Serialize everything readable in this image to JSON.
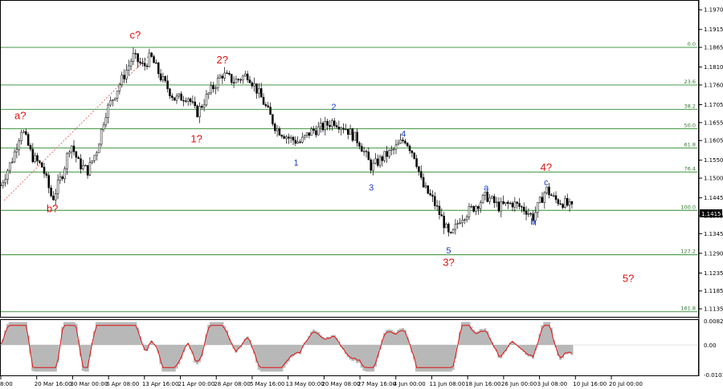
{
  "chart_data": {
    "type": "candlestick",
    "price_axis": {
      "ticks": [
        "1.1970",
        "1.1915",
        "1.1865",
        "1.1810",
        "1.1760",
        "1.1705",
        "1.1655",
        "1.1605",
        "1.1550",
        "1.1500",
        "1.1445",
        "1.1395",
        "1.1345",
        "1.1290",
        "1.1235",
        "1.1185",
        "1.1135"
      ],
      "range": [
        1.1115,
        1.1995
      ],
      "current_price": "1.1415"
    },
    "time_axis": {
      "labels": [
        "8:00",
        "20 Mar 16:00",
        "30 Mar 00:00",
        "6 Apr 08:00",
        "13 Apr 16:00",
        "21 Apr 00:00",
        "28 Apr 08:00",
        "5 May 16:00",
        "13 May 00:00",
        "20 May 08:00",
        "27 May 16:00",
        "4 Jun 00:00",
        "11 Jun 08:00",
        "18 Jun 16:00",
        "26 Jun 00:00",
        "3 Jul 08:00",
        "10 Jul 16:00",
        "20 Jul 00:00"
      ]
    },
    "fib_levels": [
      {
        "label": "0.0",
        "price": 1.1865
      },
      {
        "label": "23.6",
        "price": 1.176
      },
      {
        "label": "38.2",
        "price": 1.1692
      },
      {
        "label": "50.0",
        "price": 1.1638
      },
      {
        "label": "61.8",
        "price": 1.1584
      },
      {
        "label": "76.4",
        "price": 1.1517
      },
      {
        "label": "100.0",
        "price": 1.141
      },
      {
        "label": "127.2",
        "price": 1.1286
      },
      {
        "label": "161.8",
        "price": 1.1127
      }
    ],
    "wave_labels": [
      {
        "text": "c?",
        "color": "red",
        "price": 1.189,
        "t": 0.193
      },
      {
        "text": "a?",
        "color": "red",
        "price": 1.1665,
        "t": 0.028
      },
      {
        "text": "b?",
        "color": "red",
        "price": 1.1405,
        "t": 0.074
      },
      {
        "text": "2?",
        "color": "red",
        "price": 1.182,
        "t": 0.318
      },
      {
        "text": "1?",
        "color": "red",
        "price": 1.16,
        "t": 0.281
      },
      {
        "text": "2",
        "color": "blue",
        "price": 1.169,
        "t": 0.478
      },
      {
        "text": "1",
        "color": "blue",
        "price": 1.1535,
        "t": 0.424
      },
      {
        "text": "4",
        "color": "blue",
        "price": 1.1615,
        "t": 0.578
      },
      {
        "text": "3",
        "color": "blue",
        "price": 1.1465,
        "t": 0.532
      },
      {
        "text": "5",
        "color": "blue",
        "price": 1.129,
        "t": 0.643
      },
      {
        "text": "3?",
        "color": "red",
        "price": 1.1255,
        "t": 0.643
      },
      {
        "text": "a",
        "color": "blue",
        "price": 1.1465,
        "t": 0.697
      },
      {
        "text": "b",
        "color": "blue",
        "price": 1.137,
        "t": 0.764
      },
      {
        "text": "c",
        "color": "blue",
        "price": 1.148,
        "t": 0.783
      },
      {
        "text": "4?",
        "color": "red",
        "price": 1.152,
        "t": 0.783
      },
      {
        "text": "5?",
        "color": "red",
        "price": 1.121,
        "t": 0.901
      }
    ],
    "oscillator": {
      "ticks": [
        "0.00822",
        "0.00",
        "-0.0101"
      ],
      "range": [
        -0.0101,
        0.0082
      ]
    }
  }
}
